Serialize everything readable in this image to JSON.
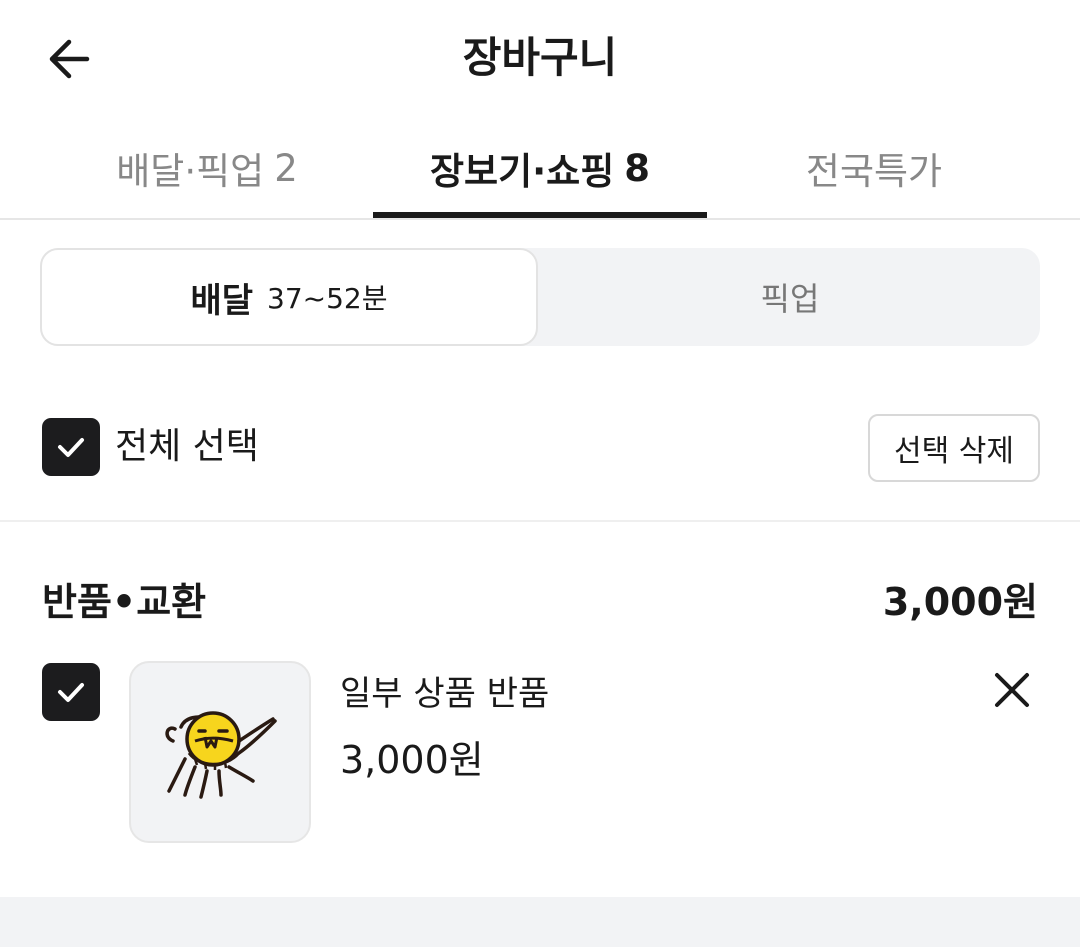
{
  "header": {
    "title": "장바구니",
    "back_icon": "arrow-left-icon"
  },
  "tabs": [
    {
      "label": "배달·픽업",
      "count": "2",
      "active": false
    },
    {
      "label": "장보기·쇼핑",
      "count": "8",
      "active": true
    },
    {
      "label": "전국특가",
      "count": "",
      "active": false
    }
  ],
  "mode_toggle": {
    "delivery_label": "배달",
    "delivery_eta": "37~52분",
    "pickup_label": "픽업",
    "selected": "배달"
  },
  "selection": {
    "select_all_label": "전체 선택",
    "select_all_checked": true,
    "delete_label": "선택 삭제"
  },
  "section": {
    "title": "반품•교환",
    "total": "3,000원",
    "items": [
      {
        "name": "일부 상품 반품",
        "price": "3,000원",
        "checked": true,
        "image_icon": "coin-character-icon"
      }
    ]
  },
  "colors": {
    "text_primary": "#1a1a1a",
    "text_muted": "#888888",
    "checkbox_fill": "#1c1c1e",
    "segment_bg": "#f2f3f5",
    "coin_yellow": "#f7d51d"
  }
}
